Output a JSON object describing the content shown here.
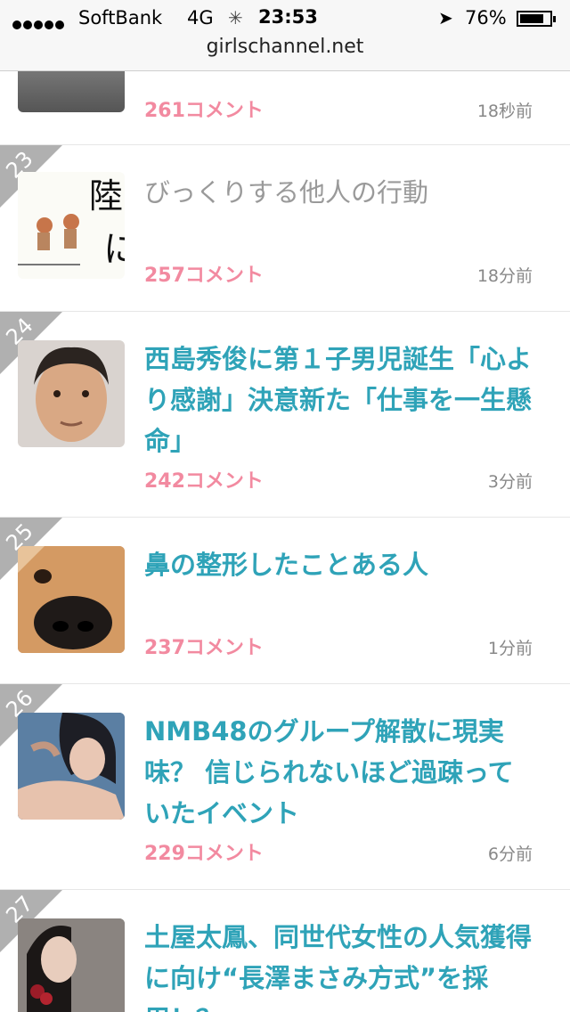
{
  "status_bar": {
    "carrier": "SoftBank",
    "network": "4G",
    "time": "23:53",
    "battery": "76%",
    "battery_level": 0.76,
    "url": "girlschannel.net"
  },
  "items": [
    {
      "rank": "",
      "title": "",
      "comments": "261コメント",
      "time": "18秒前"
    },
    {
      "rank": "23",
      "title": "びっくりする他人の行動",
      "comments": "257コメント",
      "time": "18分前"
    },
    {
      "rank": "24",
      "title": "西島秀俊に第１子男児誕生「心より感謝」決意新た「仕事を一生懸命」",
      "comments": "242コメント",
      "time": "3分前"
    },
    {
      "rank": "25",
      "title": "鼻の整形したことある人",
      "comments": "237コメント",
      "time": "1分前"
    },
    {
      "rank": "26",
      "title": "NMB48のグループ解散に現実味？ 信じられないほど過疎っていたイベント",
      "comments": "229コメント",
      "time": "6分前"
    },
    {
      "rank": "27",
      "title": "土屋太鳳、同世代女性の人気獲得に向け“長澤まさみ方式”を採用！？",
      "comments": "",
      "time": ""
    }
  ]
}
